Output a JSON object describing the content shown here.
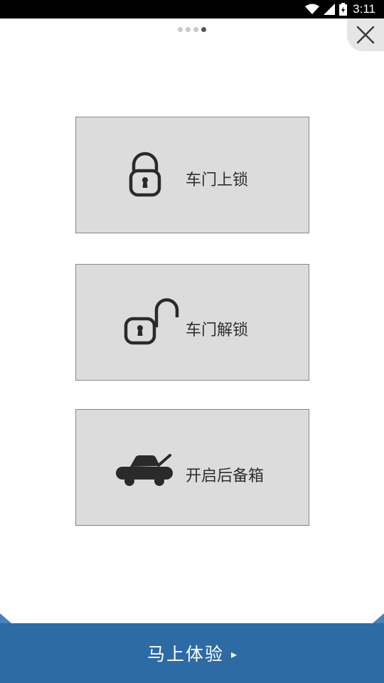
{
  "status_bar": {
    "time": "3:11",
    "icons": [
      "wifi-icon",
      "signal-icon",
      "battery-icon"
    ]
  },
  "pager": {
    "total_pages": 4,
    "current_page": 4
  },
  "close_button": {
    "icon": "close-icon"
  },
  "actions": [
    {
      "label": "车门上锁",
      "icon": "lock-closed-icon"
    },
    {
      "label": "车门解锁",
      "icon": "lock-open-icon"
    },
    {
      "label": "开启后备箱",
      "icon": "car-trunk-icon"
    }
  ],
  "cta": {
    "label": "马上体验",
    "arrow": "▸"
  },
  "colors": {
    "card_background": "#dcdcdc",
    "card_border": "#888888",
    "cta_background": "#2e6aa3",
    "cta_edge": "#4a82b8",
    "icon_color": "#2a2a2a"
  }
}
